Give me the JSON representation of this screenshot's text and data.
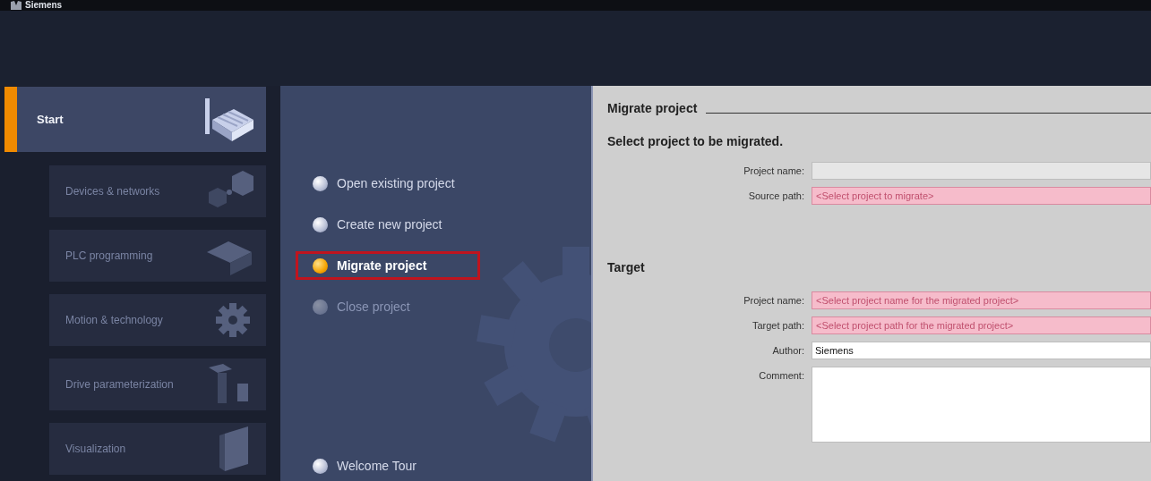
{
  "window": {
    "title": "Siemens"
  },
  "portals": [
    {
      "label": "Start",
      "selected": true,
      "children": [
        {
          "label": "Devices & networks",
          "selected": false,
          "disabled": true
        },
        {
          "label": "PLC programming",
          "selected": false,
          "disabled": true
        },
        {
          "label": "Motion & technology",
          "selected": false,
          "disabled": true
        },
        {
          "label": "Drive parameterization",
          "selected": false,
          "disabled": true
        },
        {
          "label": "Visualization",
          "selected": false,
          "disabled": true
        }
      ]
    }
  ],
  "actions": [
    {
      "label": "Open existing project",
      "selected": false,
      "disabled": false,
      "highlighted": false
    },
    {
      "label": "Create new project",
      "selected": false,
      "disabled": false,
      "highlighted": false
    },
    {
      "label": "Migrate project",
      "selected": true,
      "disabled": false,
      "highlighted": true
    },
    {
      "label": "Close project",
      "selected": false,
      "disabled": true,
      "highlighted": false
    }
  ],
  "footer_action": {
    "label": "Welcome Tour",
    "selected": false,
    "disabled": false
  },
  "content": {
    "title": "Migrate project",
    "sections": [
      {
        "heading": "Select project to be migrated.",
        "fields": [
          {
            "label": "Project name:",
            "kind": "empty"
          },
          {
            "label": "Source path:",
            "kind": "required",
            "placeholder": "<Select project to migrate>"
          }
        ]
      },
      {
        "heading": "Target",
        "fields": [
          {
            "label": "Project name:",
            "kind": "required",
            "placeholder": "<Select project name for the migrated project>"
          },
          {
            "label": "Target path:",
            "kind": "required",
            "placeholder": "<Select project path for the migrated project>"
          },
          {
            "label": "Author:",
            "kind": "text",
            "value": "Siemens"
          },
          {
            "label": "Comment:",
            "kind": "multiline"
          }
        ]
      }
    ]
  }
}
